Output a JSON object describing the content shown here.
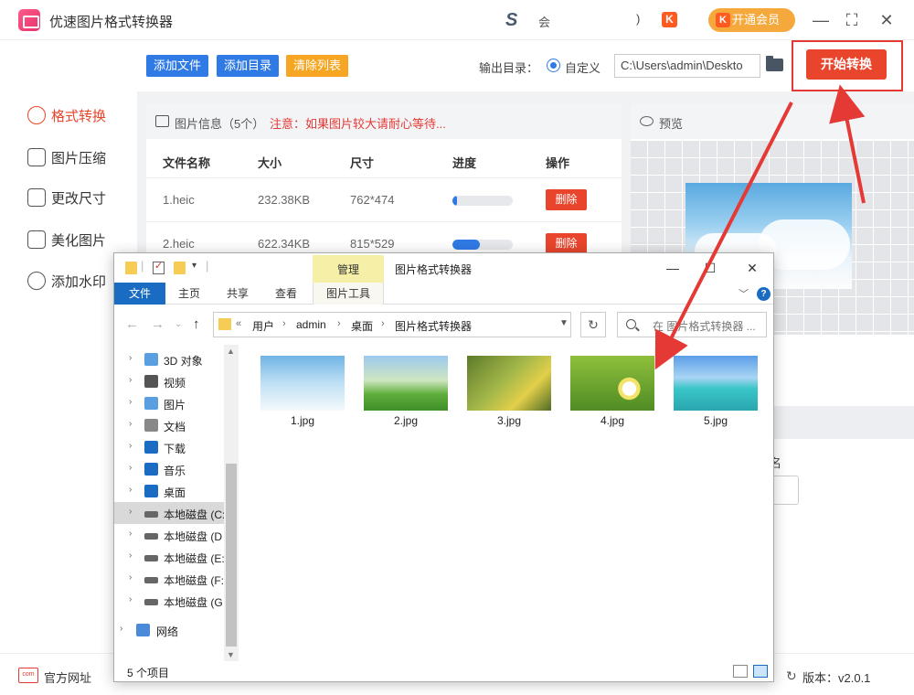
{
  "app": {
    "title": "优速图片格式转换器",
    "user_name": "会",
    "user_prefix": ")",
    "vip_label": "开通会员",
    "k_icon": "K"
  },
  "sidebar": {
    "items": [
      {
        "label": "格式转换",
        "icon": "convert-icon",
        "active": true
      },
      {
        "label": "图片压缩",
        "icon": "compress-icon"
      },
      {
        "label": "更改尺寸",
        "icon": "resize-icon"
      },
      {
        "label": "美化图片",
        "icon": "beautify-icon"
      },
      {
        "label": "添加水印",
        "icon": "watermark-icon"
      }
    ]
  },
  "toolbar": {
    "add_file": "添加文件",
    "add_dir": "添加目录",
    "clear_list": "清除列表",
    "output_label": "输出目录：",
    "custom_label": "自定义",
    "output_path": "C:\\Users\\admin\\Deskto",
    "start": "开始转换",
    "colors": {
      "add": "#2f7ae5",
      "clear": "#f6a623",
      "start": "#e8452c"
    }
  },
  "file_info": {
    "title": "图片信息（5个）",
    "note": "注意：如果图片较大请耐心等待...",
    "columns": [
      "文件名称",
      "大小",
      "尺寸",
      "进度",
      "操作"
    ],
    "rows": [
      {
        "name": "1.heic",
        "size": "232.38KB",
        "dims": "762*474",
        "progress": 0.08,
        "action": "删除"
      },
      {
        "name": "2.heic",
        "size": "622.34KB",
        "dims": "815*529",
        "progress": 0.45,
        "action": "删除"
      }
    ]
  },
  "preview": {
    "title": "预览",
    "settings_text": "名"
  },
  "bottom": {
    "official": "官方网址",
    "version": "版本：v2.0.1",
    "com_text": "com"
  },
  "explorer": {
    "manage": "管理",
    "title": "图片格式转换器",
    "ribbon_tabs": [
      "文件",
      "主页",
      "共享",
      "查看",
      "图片工具"
    ],
    "breadcrumb": [
      "用户",
      "admin",
      "桌面",
      "图片格式转换器"
    ],
    "breadcrumb_prefix": "«",
    "search_placeholder": "在 图片格式转换器 ...",
    "nav": [
      {
        "label": "3D 对象",
        "icon": "3d-objects-icon"
      },
      {
        "label": "视频",
        "icon": "video-icon"
      },
      {
        "label": "图片",
        "icon": "pictures-icon"
      },
      {
        "label": "文档",
        "icon": "documents-icon"
      },
      {
        "label": "下载",
        "icon": "download-icon"
      },
      {
        "label": "音乐",
        "icon": "music-icon"
      },
      {
        "label": "桌面",
        "icon": "desktop-icon"
      },
      {
        "label": "本地磁盘 (C:",
        "icon": "drive-c-icon",
        "selected": true
      },
      {
        "label": "本地磁盘 (D",
        "icon": "drive-icon"
      },
      {
        "label": "本地磁盘 (E:",
        "icon": "drive-icon"
      },
      {
        "label": "本地磁盘 (F:",
        "icon": "drive-icon"
      },
      {
        "label": "本地磁盘 (G",
        "icon": "drive-icon"
      },
      {
        "label": "网络",
        "icon": "network-icon"
      }
    ],
    "files": [
      "1.jpg",
      "2.jpg",
      "3.jpg",
      "4.jpg",
      "5.jpg"
    ],
    "count": "5 个项目"
  }
}
